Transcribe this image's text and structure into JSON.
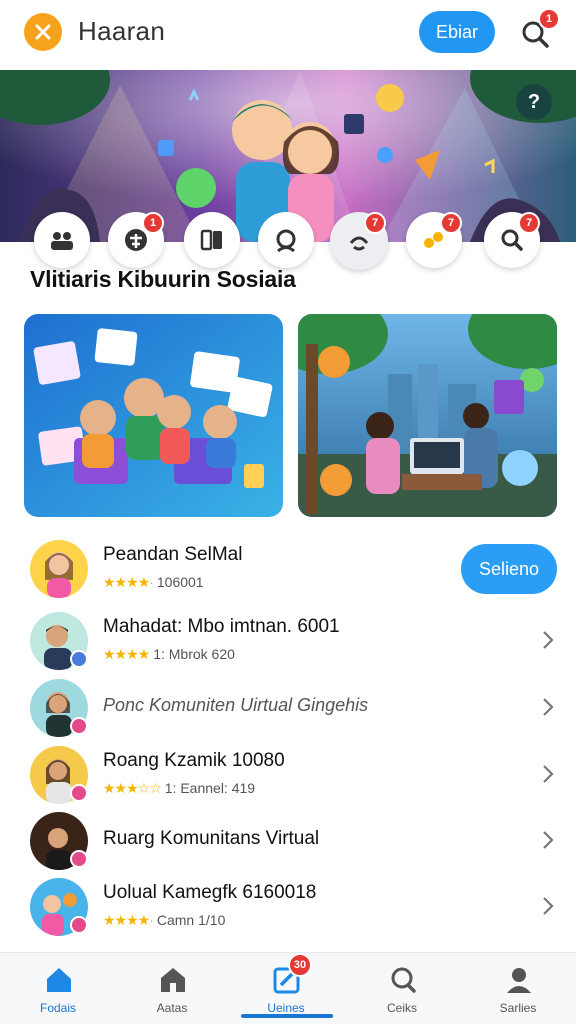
{
  "header": {
    "title": "Haaran",
    "close_icon": "close-icon",
    "primary_button": "Ebiar",
    "search_icon": "search-icon",
    "search_badge": "1",
    "colors": {
      "accent": "#2196f3",
      "close": "#f7a21b",
      "badge": "#e53935"
    }
  },
  "hero": {
    "help_label": "?"
  },
  "categories": [
    {
      "icon": "group-icon",
      "badge": ""
    },
    {
      "icon": "gift-icon",
      "badge": "1"
    },
    {
      "icon": "book-icon",
      "badge": ""
    },
    {
      "icon": "user-circle-icon",
      "badge": ""
    },
    {
      "icon": "smile-icon",
      "badge": "7"
    },
    {
      "icon": "chat-icon",
      "badge": "7"
    },
    {
      "icon": "search-icon",
      "badge": "7"
    }
  ],
  "section": {
    "title": "Vlitiaris Kibuurin Sosiaia"
  },
  "list": [
    {
      "title": "Peandan SelMal",
      "stars": "★★★★·",
      "meta": "106001",
      "action": "Selieno"
    },
    {
      "title": "Mahadat: Mbo imtnan. 6001",
      "stars": "★★★★",
      "meta": "1: Mbrok 620"
    },
    {
      "title": "Ponc Komuniten Uirtual Gingehis"
    },
    {
      "title": "Roang Kzamik 10080",
      "stars": "★★★☆☆",
      "meta": "1: Eannel: 419"
    },
    {
      "title": "Ruarg Komunitans Virtual"
    },
    {
      "title": "Uolual Kamegfk 6160018",
      "stars": "★★★★·",
      "meta": "Camn 1/10"
    }
  ],
  "bottom_nav": [
    {
      "label": "Fodais",
      "icon": "home-icon",
      "active": true
    },
    {
      "label": "Aatas",
      "icon": "store-icon",
      "active": false
    },
    {
      "label": "Ueines",
      "icon": "edit-icon",
      "active": true,
      "badge": "30"
    },
    {
      "label": "Ceiks",
      "icon": "search-icon",
      "active": false
    },
    {
      "label": "Sarlies",
      "icon": "profile-icon",
      "active": false
    }
  ]
}
